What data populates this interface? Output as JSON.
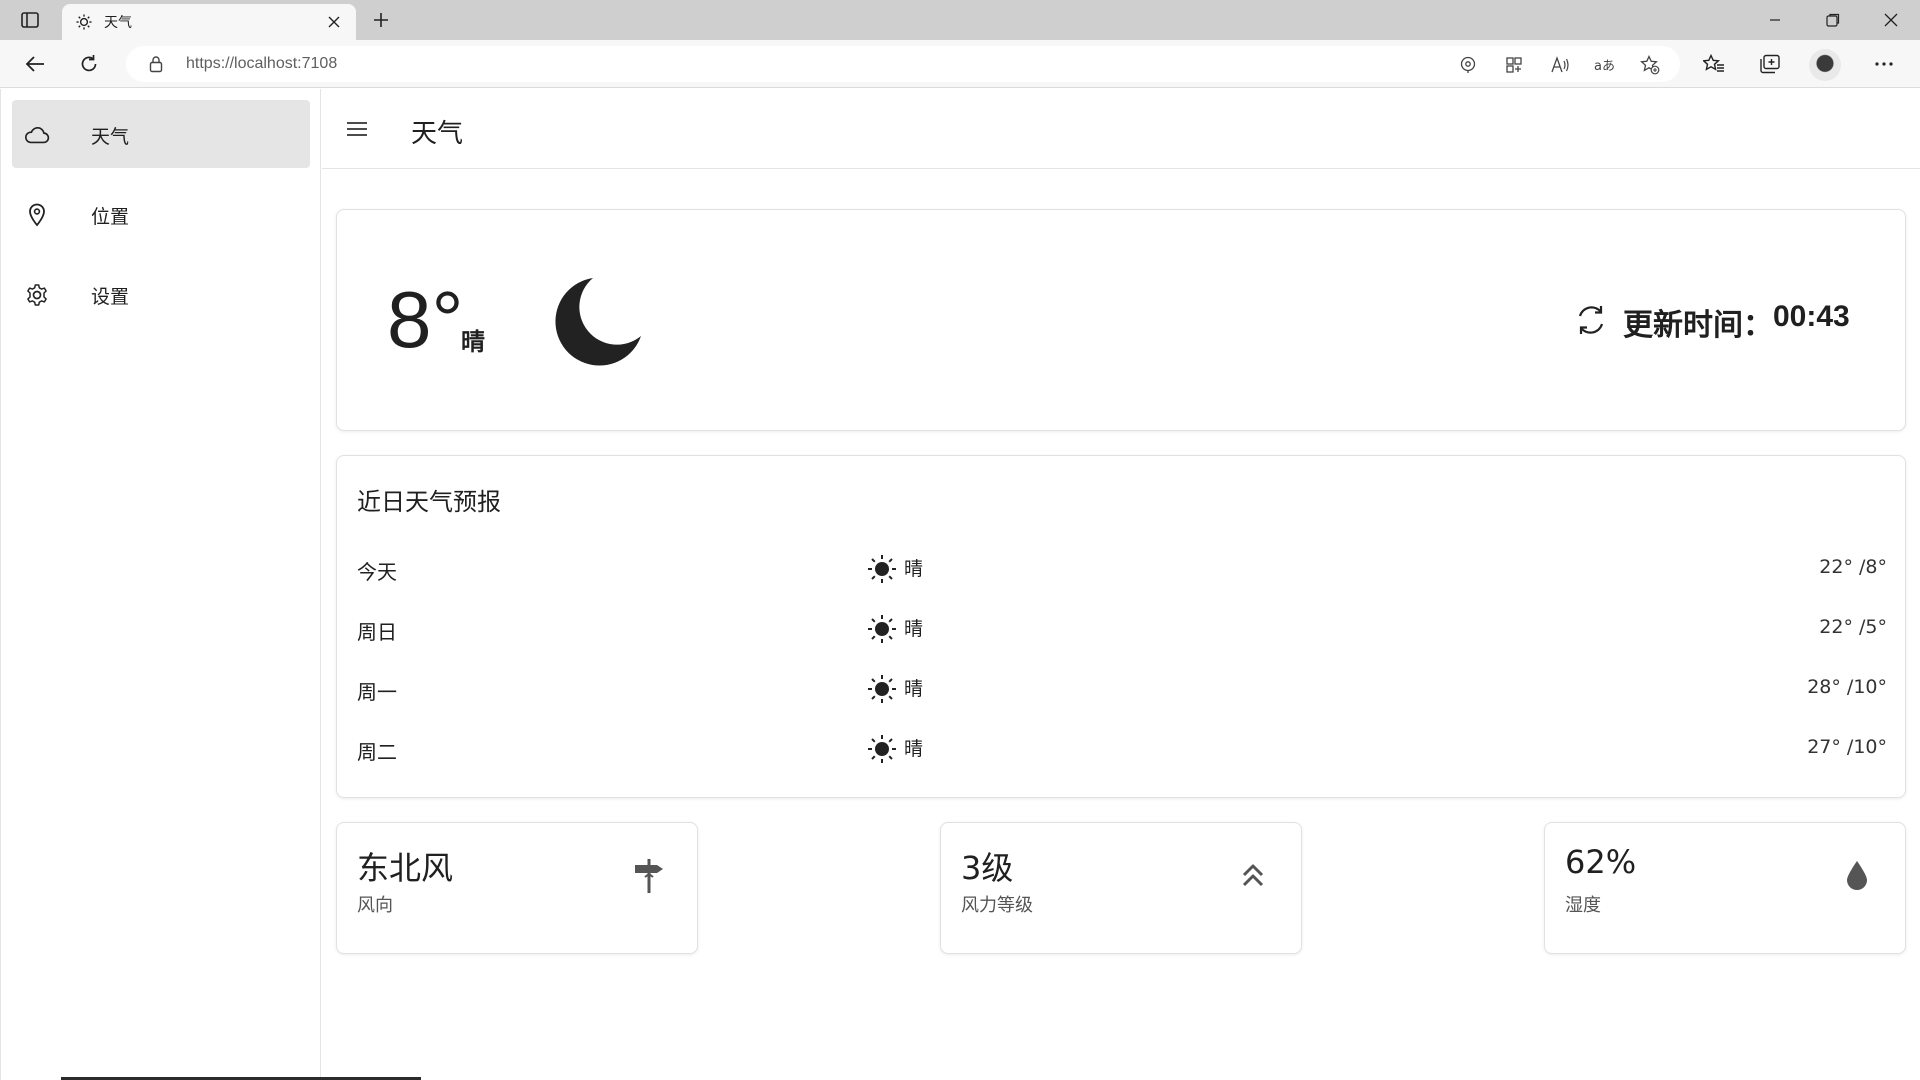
{
  "browser": {
    "tab_title": "天气",
    "url": "https://localhost:7108",
    "window_controls": [
      "minimize-icon",
      "restore-icon",
      "close-icon"
    ],
    "address_bar_icons": [
      "location-icon",
      "apps-icon",
      "read-aloud-icon",
      "translate-icon",
      "add-favorite-icon"
    ],
    "toolbar_icons": [
      "favorites-icon",
      "collections-icon",
      "profile-avatar",
      "more-icon"
    ]
  },
  "sidebar": {
    "items": [
      {
        "label": "天气",
        "icon": "cloud-icon",
        "active": true
      },
      {
        "label": "位置",
        "icon": "location-pin-icon",
        "active": false
      },
      {
        "label": "设置",
        "icon": "gear-icon",
        "active": false
      }
    ]
  },
  "header": {
    "title": "天气"
  },
  "current": {
    "temperature": "8°",
    "condition": "晴",
    "icon": "moon-icon",
    "update_label": "更新时间：",
    "update_time": "00:43"
  },
  "forecast": {
    "title": "近日天气预报",
    "days": [
      {
        "day": "今天",
        "icon": "sun-icon",
        "condition": "晴",
        "temps": "22° /8°"
      },
      {
        "day": "周日",
        "icon": "sun-icon",
        "condition": "晴",
        "temps": "22° /5°"
      },
      {
        "day": "周一",
        "icon": "sun-icon",
        "condition": "晴",
        "temps": "28° /10°"
      },
      {
        "day": "周二",
        "icon": "sun-icon",
        "condition": "晴",
        "temps": "27° /10°"
      }
    ]
  },
  "stats": [
    {
      "value": "东北风",
      "label": "风向",
      "icon": "wind-direction-icon"
    },
    {
      "value": "3级",
      "label": "风力等级",
      "icon": "wind-level-icon"
    },
    {
      "value": "62%",
      "label": "湿度",
      "icon": "humidity-drop-icon"
    }
  ],
  "colors": {
    "accent": "#202020",
    "active_nav": "#e5e5e5",
    "chrome": "#cfcfcf"
  }
}
